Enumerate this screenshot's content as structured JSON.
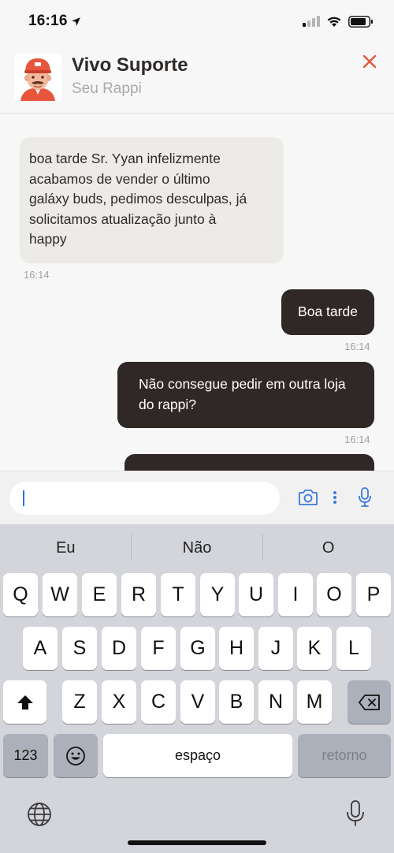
{
  "status_bar": {
    "time": "16:16"
  },
  "header": {
    "title": "Vivo Suporte",
    "subtitle": "Seu Rappi"
  },
  "messages": [
    {
      "direction": "in",
      "lines": [
        "boa tarde Sr. Yyan infelizmente",
        "acabamos de vender o último",
        "galáxy buds, pedimos desculpas, já",
        "solicitamos atualização junto à",
        "happy"
      ],
      "time": "16:14"
    },
    {
      "direction": "out",
      "lines": [
        "Boa tarde"
      ],
      "time": "16:14"
    },
    {
      "direction": "out",
      "lines": [
        "Não consegue pedir em outra loja",
        "do rappi?"
      ],
      "time": "16:14"
    }
  ],
  "composer": {
    "value": "",
    "placeholder": ""
  },
  "keyboard": {
    "suggestions": [
      "Eu",
      "Não",
      "O"
    ],
    "row1": [
      "Q",
      "W",
      "E",
      "R",
      "T",
      "Y",
      "U",
      "I",
      "O",
      "P"
    ],
    "row2": [
      "A",
      "S",
      "D",
      "F",
      "G",
      "H",
      "J",
      "K",
      "L"
    ],
    "row3": [
      "Z",
      "X",
      "C",
      "V",
      "B",
      "N",
      "M"
    ],
    "numbers_key": "123",
    "space_key": "espaço",
    "return_key": "retorno"
  },
  "colors": {
    "accent": "#e8553d",
    "bubble_out": "#2f2826",
    "bubble_in": "#ecebe7",
    "icon_blue": "#3b7bdc"
  }
}
